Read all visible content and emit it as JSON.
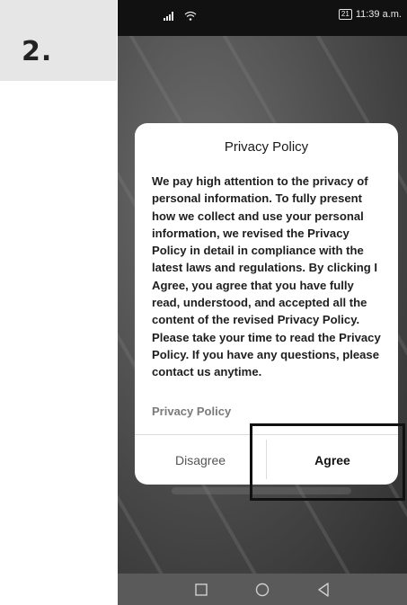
{
  "step": {
    "label": "2."
  },
  "status_bar": {
    "signal": "ᴴᵈ",
    "time": "11:39 a.m.",
    "battery": "21"
  },
  "dialog": {
    "title": "Privacy Policy",
    "body": "We pay high attention to the privacy of personal information. To fully present how we collect and use your personal information, we revised the Privacy Policy in detail in compliance with the latest laws and regulations. By clicking I Agree, you agree that you have fully read, understood, and accepted all the content of the revised Privacy Policy. Please take your time to read the Privacy Policy. If you have any questions, please contact us anytime.",
    "policy_link": "Privacy Policy",
    "disagree_label": "Disagree",
    "agree_label": "Agree"
  },
  "nav_bar": {
    "icons": [
      "square-icon",
      "circle-icon",
      "back-triangle-icon"
    ]
  }
}
